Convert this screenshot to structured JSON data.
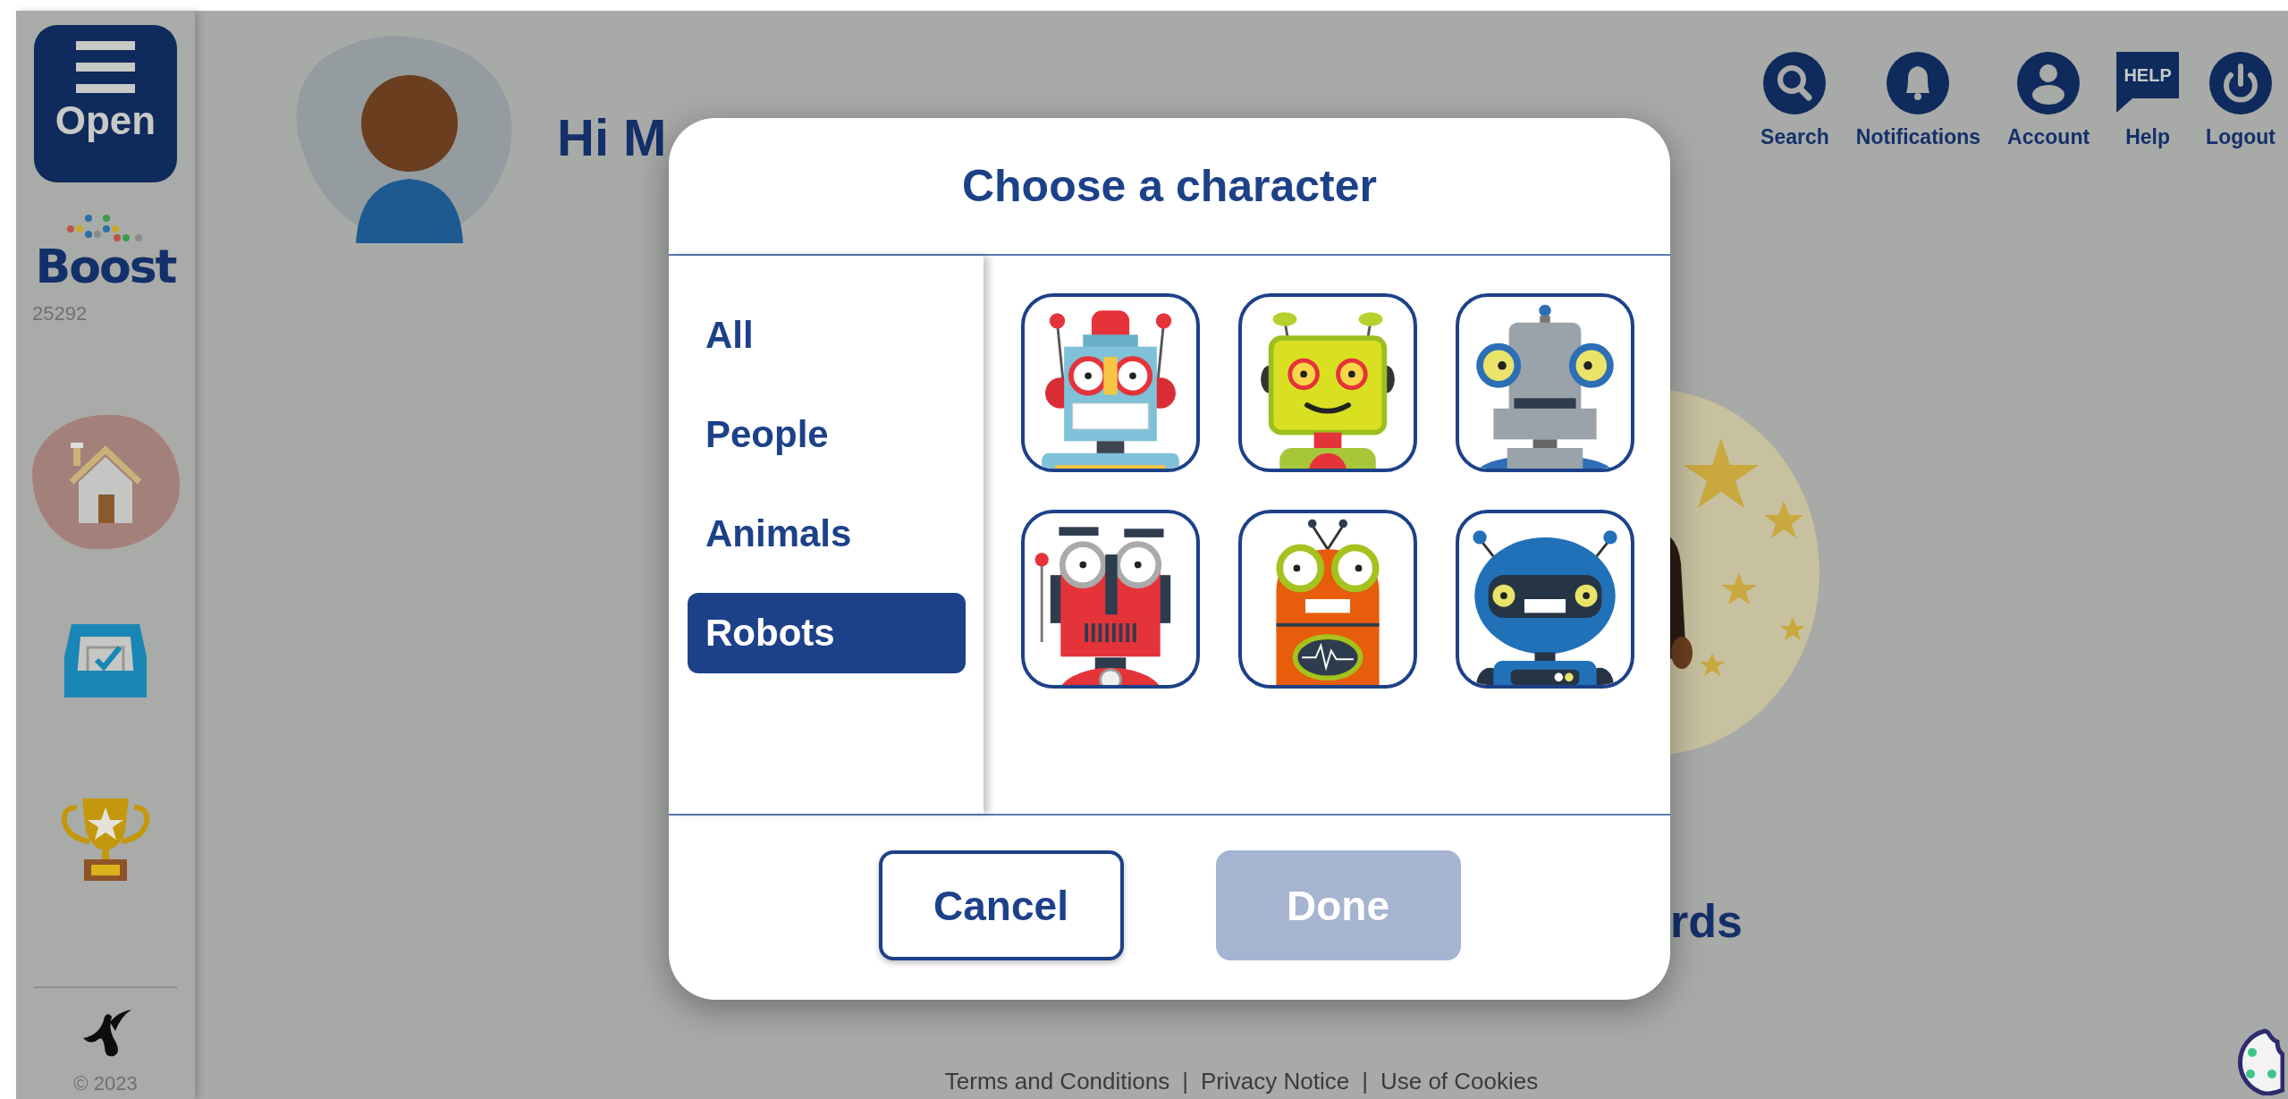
{
  "sidebar": {
    "open_button": {
      "label": "Open"
    },
    "logo": {
      "text": "Boost"
    },
    "school_code": "25292",
    "nav": [
      {
        "selected": true
      },
      {
        "selected": false
      },
      {
        "selected": false
      }
    ],
    "copyright": "© 2023"
  },
  "header": {
    "greeting": "Hi M",
    "top_nav": [
      {
        "label": "Search"
      },
      {
        "label": "Notifications"
      },
      {
        "label": "Account"
      },
      {
        "label": "Help",
        "badge": "HELP"
      },
      {
        "label": "Logout"
      }
    ]
  },
  "background_card": {
    "title": "rds"
  },
  "footer": {
    "links": [
      "Terms and Conditions",
      "Privacy Notice",
      "Use of Cookies"
    ],
    "separators": [
      "|",
      "|"
    ]
  },
  "dialog": {
    "title": "Choose a character",
    "categories": [
      {
        "label": "All",
        "selected": false
      },
      {
        "label": "People",
        "selected": false
      },
      {
        "label": "Animals",
        "selected": false
      },
      {
        "label": "Robots",
        "selected": true
      }
    ],
    "characters": [
      {
        "selected": false
      },
      {
        "selected": false
      },
      {
        "selected": false
      },
      {
        "selected": false
      },
      {
        "selected": false
      },
      {
        "selected": false
      }
    ],
    "buttons": [
      {
        "label": "Cancel",
        "kind": "secondary",
        "disabled": false
      },
      {
        "label": "Done",
        "kind": "primary",
        "disabled": true
      }
    ]
  }
}
